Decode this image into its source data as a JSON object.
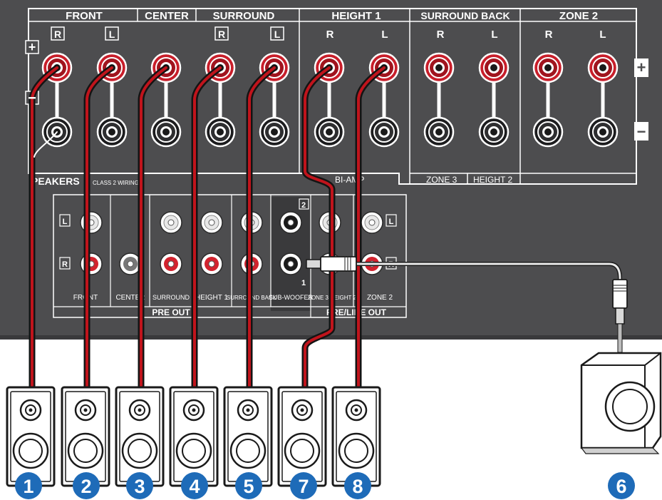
{
  "colors": {
    "panel": "#4d4d4f",
    "panel_dark": "#3a3a3c",
    "line": "#ffffff",
    "terminal_red": "#c81e2a",
    "terminal_black": "#1c1c1e",
    "cable_red": "#c0141c",
    "cable_black": "#141414",
    "badge": "#1e6bb8",
    "speaker_fill": "#ffffff",
    "speaker_stroke": "#1a1a1a"
  },
  "speaker_section": {
    "headers": [
      "FRONT",
      "CENTER",
      "SURROUND",
      "HEIGHT 1",
      "SURROUND BACK",
      "ZONE 2"
    ],
    "channel_letters": [
      "R",
      "L",
      "R",
      "L",
      "R",
      "L",
      "R",
      "L",
      "R",
      "L"
    ],
    "plus_symbol": "+",
    "minus_symbol": "−",
    "title": "PEAKERS",
    "wiring_note": "CLASS 2 WIRING",
    "biamp_label": "BI-AMP",
    "zone3_label": "ZONE 3",
    "height2_label": "HEIGHT 2"
  },
  "preout_section": {
    "side_letters": [
      "L",
      "R"
    ],
    "sub_number_top": "2",
    "sub_number_bottom": "1",
    "column_labels": [
      "FRONT",
      "CENTER",
      "SURROUND",
      "HEIGHT 1",
      "SURROUND BACK",
      "SUB-WOOFER",
      "ZONE 3 HEIGHT 2",
      "ZONE 2"
    ],
    "group_left": "PRE OUT",
    "group_right": "PRE/LINE OUT",
    "right_side_letters": [
      "L",
      "R"
    ]
  },
  "speakers": [
    {
      "badge": "1"
    },
    {
      "badge": "2"
    },
    {
      "badge": "3"
    },
    {
      "badge": "4"
    },
    {
      "badge": "5"
    },
    {
      "badge": "7"
    },
    {
      "badge": "8"
    }
  ],
  "subwoofer": {
    "badge": "6"
  }
}
